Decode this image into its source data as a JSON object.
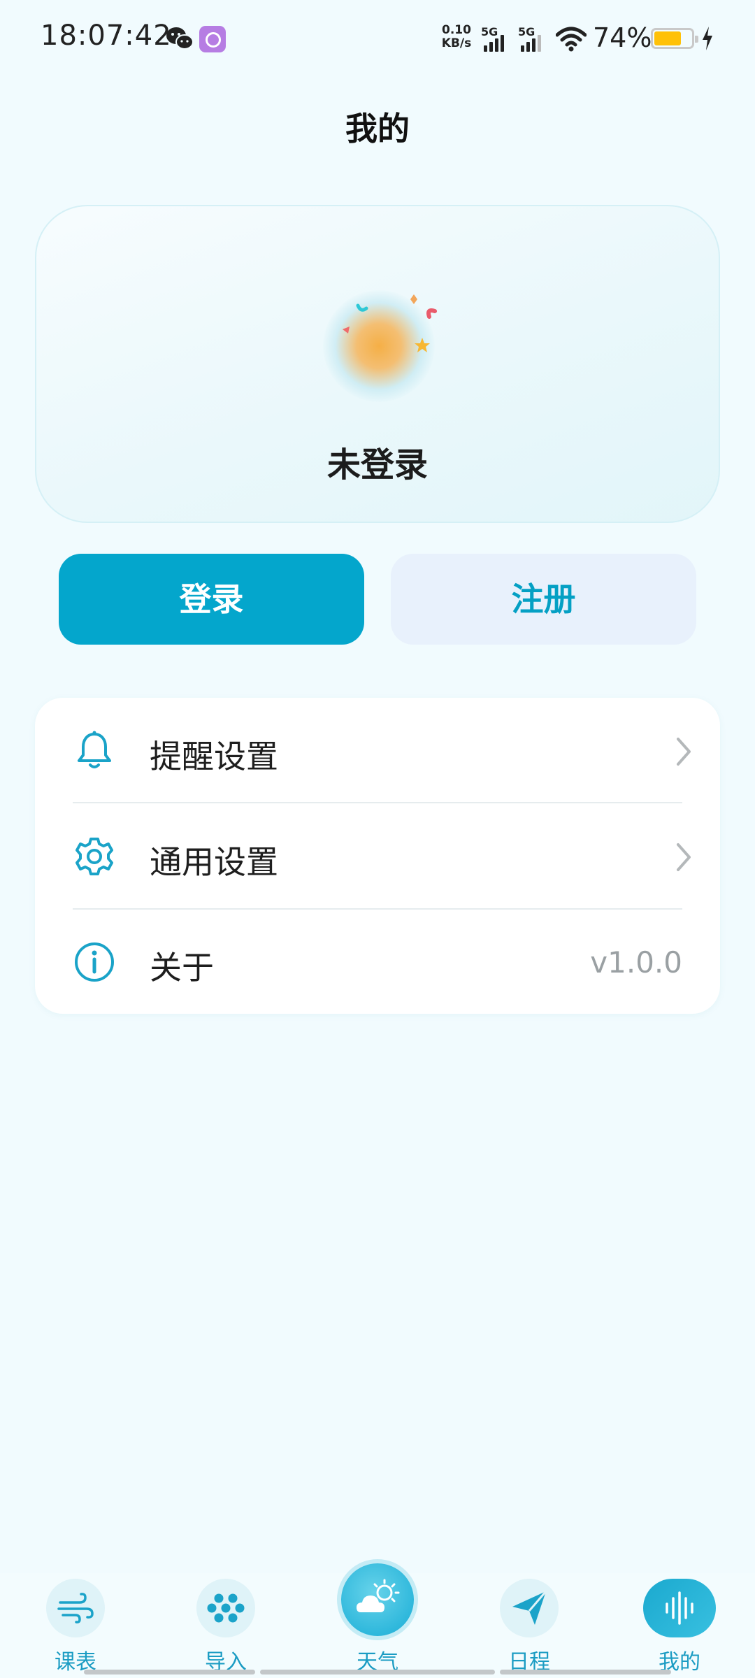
{
  "status_bar": {
    "time": "18:07:42",
    "net_speed_value": "0.10",
    "net_speed_unit": "KB/s",
    "signal1_label": "5G",
    "signal2_label": "5G",
    "battery_percent": "74%",
    "battery_level": 0.74,
    "battery_color": "#ffc107",
    "icons": [
      "wechat-icon",
      "app-notification-icon",
      "wifi-icon",
      "battery-icon",
      "charging-icon"
    ]
  },
  "header": {
    "title": "我的"
  },
  "profile": {
    "status_text": "未登录"
  },
  "actions": {
    "login_label": "登录",
    "register_label": "注册"
  },
  "settings": {
    "items": [
      {
        "label": "提醒设置",
        "icon": "bell-icon",
        "trailing": "chevron"
      },
      {
        "label": "通用设置",
        "icon": "gear-icon",
        "trailing": "chevron"
      },
      {
        "label": "关于",
        "icon": "info-icon",
        "value": "v1.0.0"
      }
    ]
  },
  "bottom_nav": {
    "items": [
      {
        "label": "课表",
        "icon": "wind-icon"
      },
      {
        "label": "导入",
        "icon": "dots-grid-icon"
      },
      {
        "label": "天气",
        "icon": "weather-icon"
      },
      {
        "label": "日程",
        "icon": "send-icon"
      },
      {
        "label": "我的",
        "icon": "soundwave-icon",
        "active": true
      }
    ]
  },
  "colors": {
    "accent": "#04a6cc",
    "background": "#f1fbfe",
    "register_bg": "#e8f1fc",
    "nav_label": "#1b9cc3"
  }
}
